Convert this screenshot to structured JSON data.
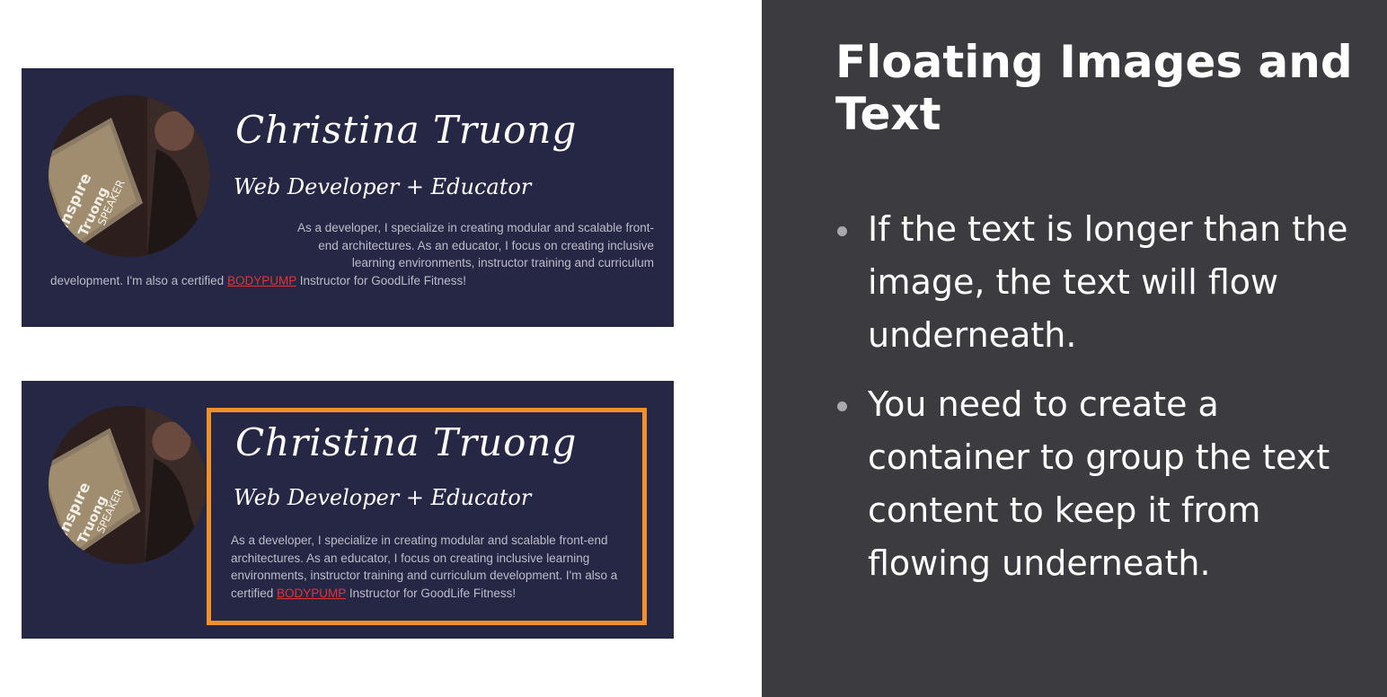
{
  "example_one": {
    "name": "Christina Truong",
    "title": "Web Developer + Educator",
    "bio_lines": [
      "As a developer, I specialize in creating modular and scalable front-",
      "end architectures. As an educator, I focus on creating inclusive",
      "learning environments, instructor training and curriculum"
    ],
    "bio_last_before": "development. I'm also a certified ",
    "bio_link": "BODYPUMP",
    "bio_last_after": " Instructor for GoodLife Fitness!"
  },
  "example_two": {
    "name": "Christina Truong",
    "title": "Web Developer + Educator",
    "bio_before": "As a developer, I specialize in creating modular and scalable front-end architectures. As an educator, I focus on creating inclusive learning environments, instructor training and curriculum development. I'm also a certified ",
    "bio_link": "BODYPUMP",
    "bio_after": " Instructor for GoodLife Fitness!",
    "container_color": "#f0912a"
  },
  "slide": {
    "heading": "Floating Images and Text",
    "bullets": [
      "If the text is longer than the image, the text will flow underneath.",
      "You need to create a container to group the text content to keep it from flowing underneath."
    ]
  },
  "colors": {
    "card_bg": "#262744",
    "panel_bg": "#3b3b40",
    "link": "#e0343a",
    "accent": "#f0912a"
  }
}
